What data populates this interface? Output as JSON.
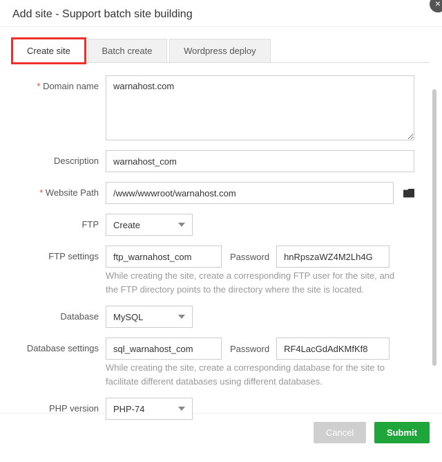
{
  "title": "Add site - Support batch site building",
  "tabs": {
    "create": "Create site",
    "batch": "Batch create",
    "wp": "Wordpress deploy"
  },
  "labels": {
    "domain": "Domain name",
    "desc": "Description",
    "path": "Website Path",
    "ftp": "FTP",
    "ftpset": "FTP settings",
    "pw": "Password",
    "db": "Database",
    "dbset": "Database settings",
    "php": "PHP version"
  },
  "values": {
    "domain": "warnahost.com",
    "desc": "warnahost_com",
    "path": "/www/wwwroot/warnahost.com",
    "ftp_sel": "Create",
    "ftp_user": "ftp_warnahost_com",
    "ftp_pw": "hnRpszaWZ4M2Lh4G",
    "db_sel": "MySQL",
    "db_user": "sql_warnahost_com",
    "db_pw": "RF4LacGdAdKMfKf8",
    "php_sel": "PHP-74"
  },
  "hints": {
    "ftp": "While creating the site, create a corresponding FTP user for the site, and the FTP directory points to the directory where the site is located.",
    "db": "While creating the site, create a corresponding database for the site to facilitate different databases using different databases."
  },
  "buttons": {
    "cancel": "Cancel",
    "submit": "Submit"
  }
}
